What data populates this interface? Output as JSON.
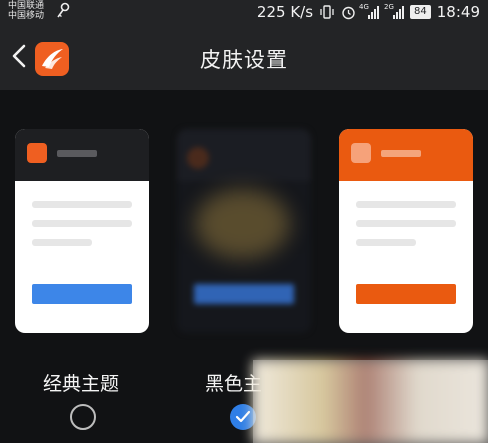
{
  "status_bar": {
    "carrier_1": "中国联通",
    "carrier_2": "中国移动",
    "net_speed": "225 K/s",
    "signal_1_tag": "4G",
    "signal_2_tag": "2G",
    "battery": "84",
    "time": "18:49"
  },
  "header": {
    "title": "皮肤设置"
  },
  "themes": [
    {
      "label": "经典主题",
      "selected": false,
      "accent": "#3d86e8"
    },
    {
      "label": "黑色主",
      "selected": true,
      "accent": "#2f7ee6"
    },
    {
      "label": "",
      "selected": false,
      "accent": "#ea5a10"
    }
  ],
  "colors": {
    "brand": "#ef5f21",
    "background": "#111214",
    "bar": "#232426"
  }
}
